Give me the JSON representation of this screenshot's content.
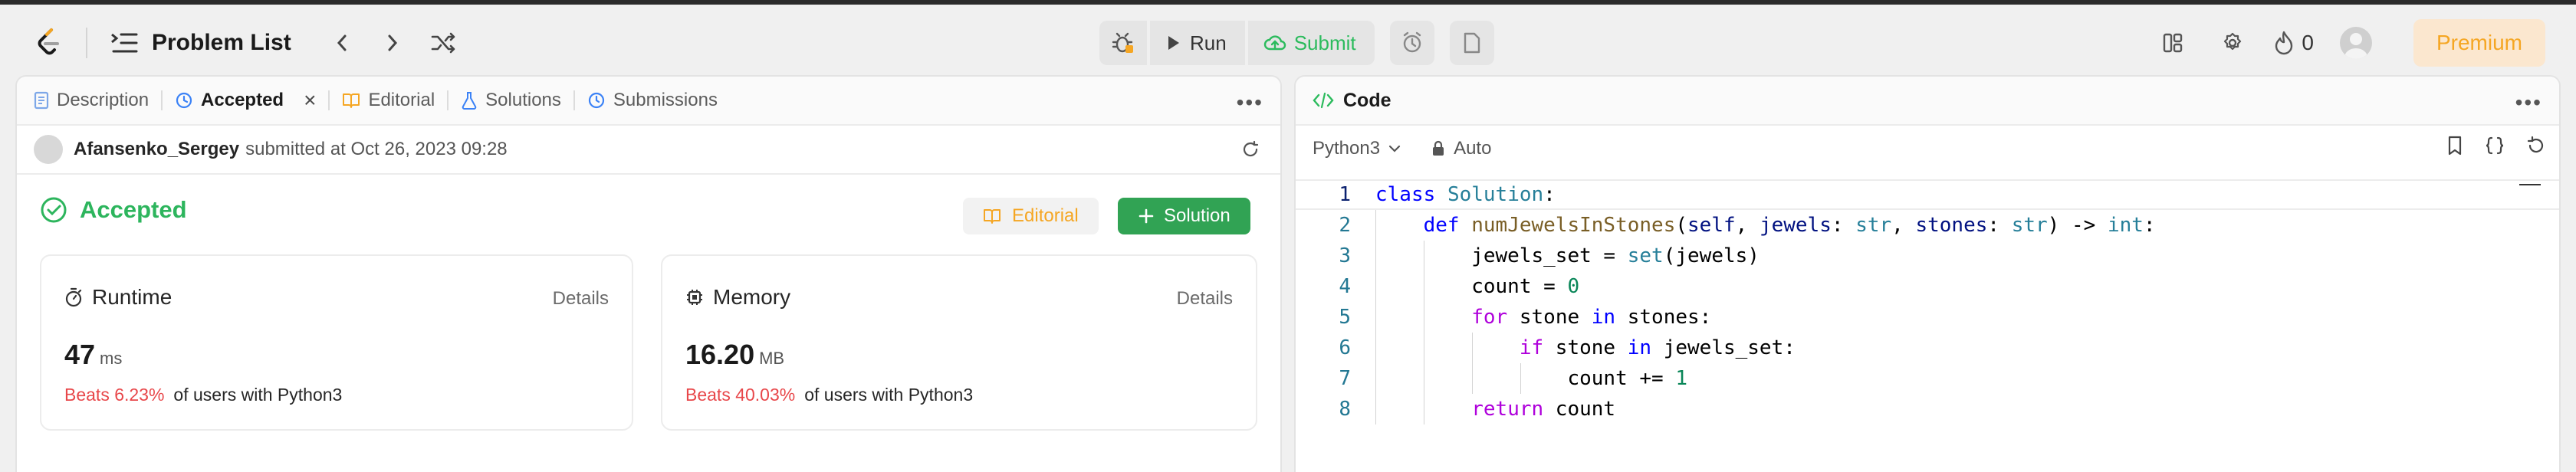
{
  "header": {
    "title": "Problem List",
    "run_label": "Run",
    "submit_label": "Submit",
    "streak_count": "0",
    "premium_label": "Premium"
  },
  "left": {
    "tabs": [
      {
        "label": "Description"
      },
      {
        "label": "Accepted"
      },
      {
        "label": "Editorial"
      },
      {
        "label": "Solutions"
      },
      {
        "label": "Submissions"
      }
    ],
    "submitter": "Afansenko_Sergey",
    "submitted_text": "submitted at Oct 26, 2023 09:28",
    "status": "Accepted",
    "editorial_button": "Editorial",
    "solution_button": "Solution",
    "runtime": {
      "title": "Runtime",
      "details": "Details",
      "value": "47",
      "unit": "ms",
      "beats": "Beats 6.23%",
      "beats_suffix": "of users with Python3"
    },
    "memory": {
      "title": "Memory",
      "details": "Details",
      "value": "16.20",
      "unit": "MB",
      "beats": "Beats 40.03%",
      "beats_suffix": "of users with Python3"
    }
  },
  "right": {
    "tab_label": "Code",
    "language": "Python3",
    "mode": "Auto",
    "line_numbers": [
      "1",
      "2",
      "3",
      "4",
      "5",
      "6",
      "7",
      "8"
    ]
  },
  "colors": {
    "accent_green": "#2cbb5d",
    "accepted_green": "#2db55d",
    "beats_red": "#e8474a",
    "premium_orange": "#f5a623"
  }
}
